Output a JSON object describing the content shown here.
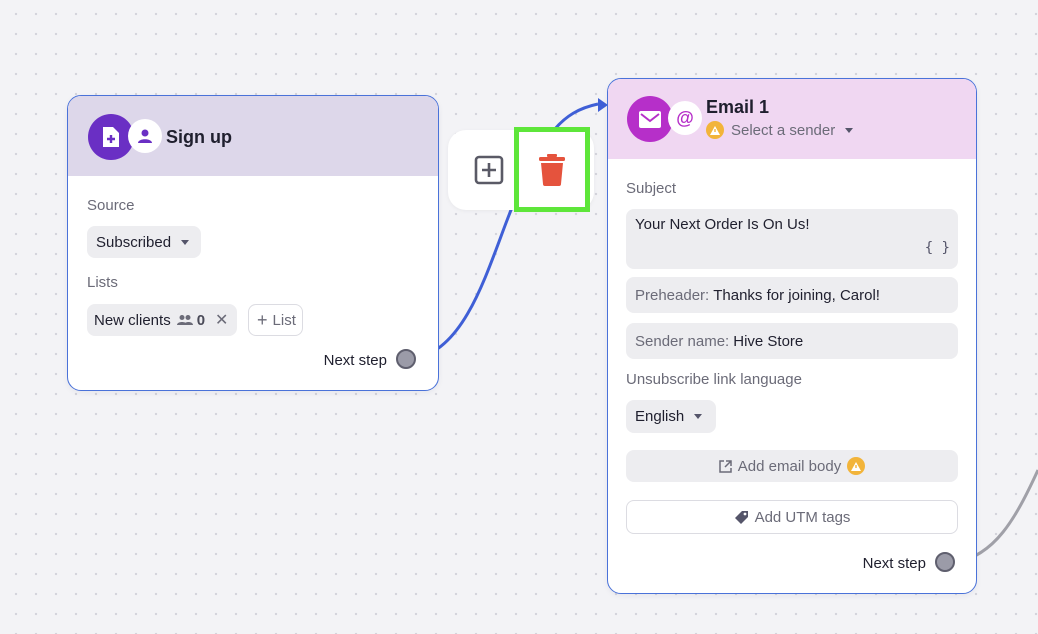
{
  "signup_node": {
    "title": "Sign up",
    "source_label": "Source",
    "source_value": "Subscribed",
    "lists_label": "Lists",
    "list_chip_name": "New clients",
    "list_chip_count": "0",
    "add_list_label": "List",
    "next_step_label": "Next step"
  },
  "email_node": {
    "title": "Email 1",
    "sender_placeholder": "Select a sender",
    "subject_label": "Subject",
    "subject_value": "Your Next Order Is On Us!",
    "variable_button": "{ }",
    "preheader_label": "Preheader:",
    "preheader_value": "Thanks for joining, Carol!",
    "sender_name_label": "Sender name:",
    "sender_name_value": "Hive Store",
    "unsubscribe_label": "Unsubscribe link language",
    "language_value": "English",
    "add_body_label": "Add email body",
    "add_utm_label": "Add UTM tags",
    "next_step_label": "Next step"
  },
  "edge_toolbar": {
    "add_icon": "plus-square-icon",
    "delete_icon": "trash-icon",
    "highlight_color": "#5ee63a"
  },
  "colors": {
    "accent": "#4a72d9",
    "signup_header": "#ddd7ea",
    "email_header": "#f0d7f2",
    "purple": "#6a2fc4",
    "magenta": "#b62fc9",
    "delete_red": "#e5533d",
    "warning": "#f2b43a"
  }
}
